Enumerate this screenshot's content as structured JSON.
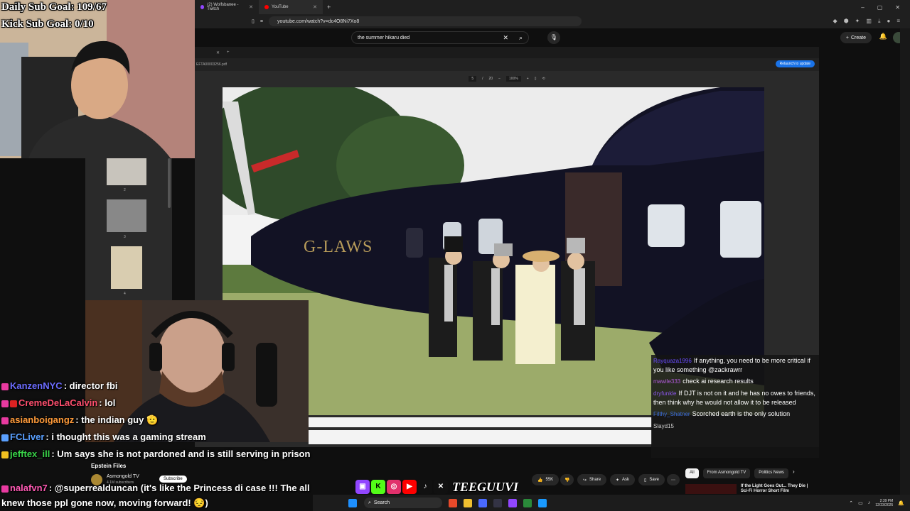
{
  "browser": {
    "tabs": [
      {
        "label": "(2) Wolfsbanee - Twitch",
        "color": "#9146ff",
        "active": false
      },
      {
        "label": "YouTube",
        "color": "#ff0000",
        "active": true
      }
    ],
    "new_tab": "+",
    "url": "youtube.com/watch?v=dc4O8Ni7Xo8",
    "window_controls": [
      "–",
      "▢",
      "✕"
    ]
  },
  "youtube": {
    "search_value": "the summer hikaru died",
    "create_label": "Create",
    "channel_title": "Epstein Files",
    "channel_name": "Asmongold TV",
    "channel_subs": "4.1M subscribers",
    "subscribe_label": "Subscribe",
    "likes": "55K",
    "share_label": "Share",
    "ask_label": "Ask",
    "save_label": "Save",
    "chips": [
      "All",
      "From Asmongold TV",
      "Politics News"
    ],
    "rec_title": "If the Light Goes Out... They Die | Sci-Fi Horror Short Film"
  },
  "pdf": {
    "filename": "EFTA00003256.pdf",
    "page_current": "5",
    "page_total": "20",
    "zoom": "100%",
    "relaunch_label": "Relaunch to update",
    "thumb_numbers": [
      "2",
      "3",
      "4"
    ]
  },
  "photo": {
    "helicopter_text": "G-LAWS"
  },
  "overlay": {
    "daily_goal": "Daily Sub Goal: 109/67",
    "kick_goal": "Kick Sub Goal: 0/10",
    "logo_text": "TEEGUUVI"
  },
  "video_chat": [
    {
      "name": "Rayquaza1996",
      "text": "If anything, you need to be more critical if you like something @zackrawrr",
      "color": "#6a4cff"
    },
    {
      "name": "mawile333",
      "text": "check ai research results",
      "color": "#b05ad8"
    },
    {
      "name": "dryfunkle",
      "text": "If DJT is not on it and he has no owes to friends, then think why he would not allow it to be released",
      "color": "#8a56e8"
    },
    {
      "name": "Filthy_Shatner",
      "text": "Scorched earth is the only solution",
      "color": "#3a6ad8"
    },
    {
      "name": "Slayd15",
      "text": "",
      "color": "#cfcfcf"
    }
  ],
  "chat": [
    {
      "name": "KanzenNYC",
      "text": ": director fbi",
      "color": "#6c6cff"
    },
    {
      "name": "CremeDeLaCalvin",
      "text": ": lol",
      "color": "#ff4f6e"
    },
    {
      "name": "asianboigangz",
      "text": ": the indian guy 🫡",
      "color": "#ff9b3a"
    },
    {
      "name": "FCLiver",
      "text": ": i thought this was a gaming stream",
      "color": "#5aa0ff"
    },
    {
      "name": "jefftex_ill",
      "text": ": Um says she is not pardoned and is still serving in prison",
      "color": "#3ad84a"
    },
    {
      "name": "nalafvn7",
      "text": ": @superrealduncan (it's like the Princess di case !!! The all knew those ppl gone now, moving forward! 😔)",
      "color": "#ff5ab4"
    }
  ],
  "taskbar": {
    "search_label": "Search",
    "time": "2:39 PM",
    "date": "12/23/2025"
  },
  "colors": {
    "bg": "#0f0f0f",
    "accent": "#ff0000"
  }
}
